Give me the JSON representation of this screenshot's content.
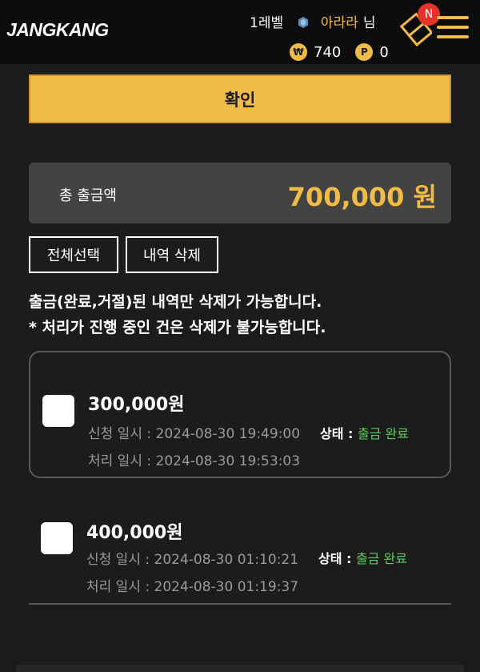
{
  "header": {
    "logo": {
      "part1": "JANG",
      "part2": "KANG"
    },
    "level": "1레벨",
    "nickname": "아라라",
    "nickname_suffix": "님",
    "won_symbol": "₩",
    "won_balance": "740",
    "point_symbol": "P",
    "point_balance": "0",
    "notification_badge": "N",
    "accent_color": "#f1bb47"
  },
  "confirm_button": "확인",
  "total": {
    "label": "총 출금액",
    "amount": "700,000 원"
  },
  "actions": {
    "select_all": "전체선택",
    "delete_history": "내역 삭제"
  },
  "notices": {
    "line1": "출금(완료,거절)된 내역만 삭제가 가능합니다.",
    "line2": "* 처리가 진행 중인 건은 삭제가 불가능합니다."
  },
  "withdrawals": [
    {
      "amount": "300,000원",
      "requested": "신청 일시 : 2024-08-30 19:49:00",
      "processed": "처리 일시 : 2024-08-30 19:53:03",
      "status_label": "상태 : ",
      "status_value": "출금 완료"
    },
    {
      "amount": "400,000원",
      "requested": "신청 일시 : 2024-08-30 01:10:21",
      "processed": "처리 일시 : 2024-08-30 01:19:37",
      "status_label": "상태 : ",
      "status_value": "출금 완료"
    }
  ]
}
